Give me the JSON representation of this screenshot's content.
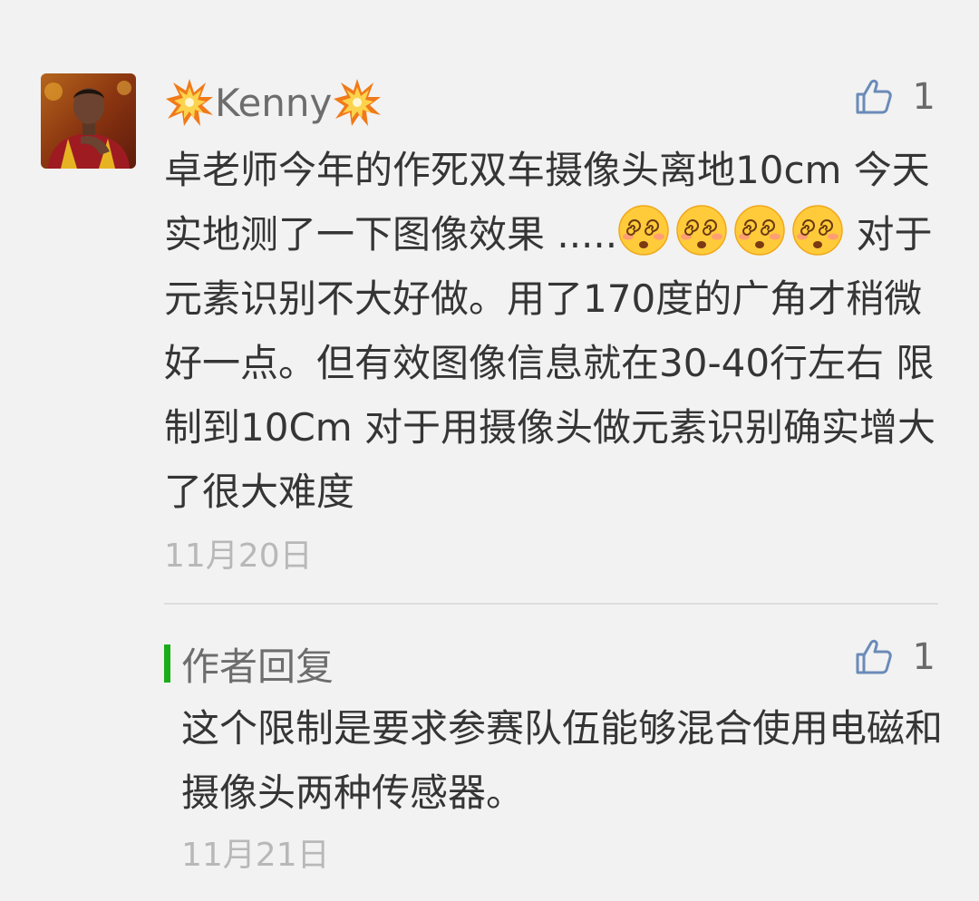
{
  "comment": {
    "username": "Kenny",
    "username_decoration": "collision-emoji",
    "likes": "1",
    "text_part1": "卓老师今年的作死双车摄像头离地10cm 今天实地测了一下图像效果 .....",
    "emojis": [
      "dizzy-face-emoji",
      "dizzy-face-emoji",
      "dizzy-face-emoji",
      "dizzy-face-emoji"
    ],
    "text_part2": " 对于元素识别不大好做。用了170度的广角才稍微好一点。但有效图像信息就在30-40行左右 限制到10Cm 对于用摄像头做元素识别确实增大了很大难度",
    "date": "11月20日"
  },
  "reply": {
    "label": "作者回复",
    "likes": "1",
    "text": "这个限制是要求参赛队伍能够混合使用电磁和摄像头两种传感器。",
    "date": "11月21日"
  },
  "colors": {
    "background": "#f2f2f2",
    "body_text": "#353535",
    "secondary_text": "#6d6d6d",
    "date_text": "#b8b8b8",
    "thumb_icon": "#6a8bb8",
    "reply_accent": "#1aad19",
    "divider": "#dddddd"
  }
}
